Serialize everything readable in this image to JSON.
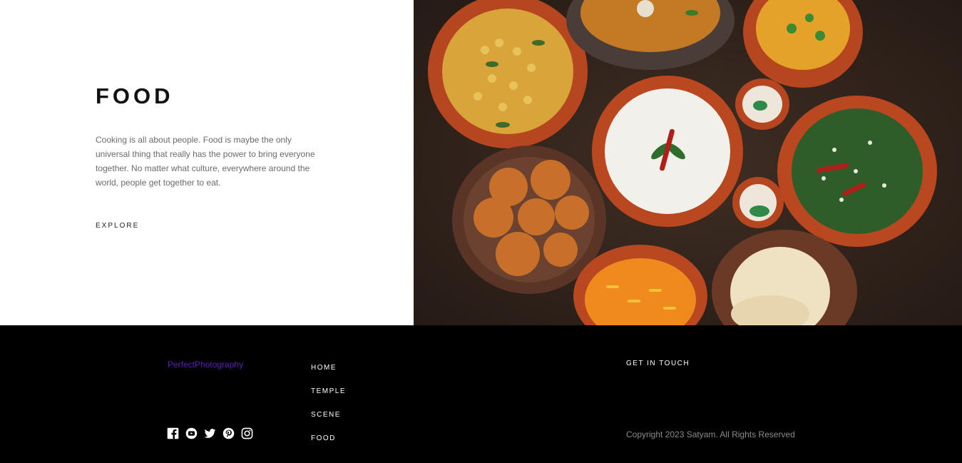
{
  "hero": {
    "title": "FOOD",
    "description": "Cooking is all about people. Food is maybe the only universal thing that really has the power to bring everyone together. No matter what culture, everywhere around the world, people get together to eat.",
    "cta_label": "EXPLORE"
  },
  "footer": {
    "brand": "PerfectPhotography",
    "nav": [
      {
        "label": "HOME"
      },
      {
        "label": "TEMPLE"
      },
      {
        "label": "SCENE"
      },
      {
        "label": "FOOD"
      }
    ],
    "contact_heading": "GET IN TOUCH",
    "copyright": "Copyright 2023 Satyam. All Rights Reserved",
    "socials": [
      {
        "icon": "facebook-icon"
      },
      {
        "icon": "youtube-icon"
      },
      {
        "icon": "twitter-icon"
      },
      {
        "icon": "pinterest-icon"
      },
      {
        "icon": "instagram-icon"
      }
    ]
  },
  "colors": {
    "brand_link": "#5b1fb3",
    "footer_bg": "#000000",
    "table_bg": "#3a2a22",
    "clay": "#c4532a"
  }
}
